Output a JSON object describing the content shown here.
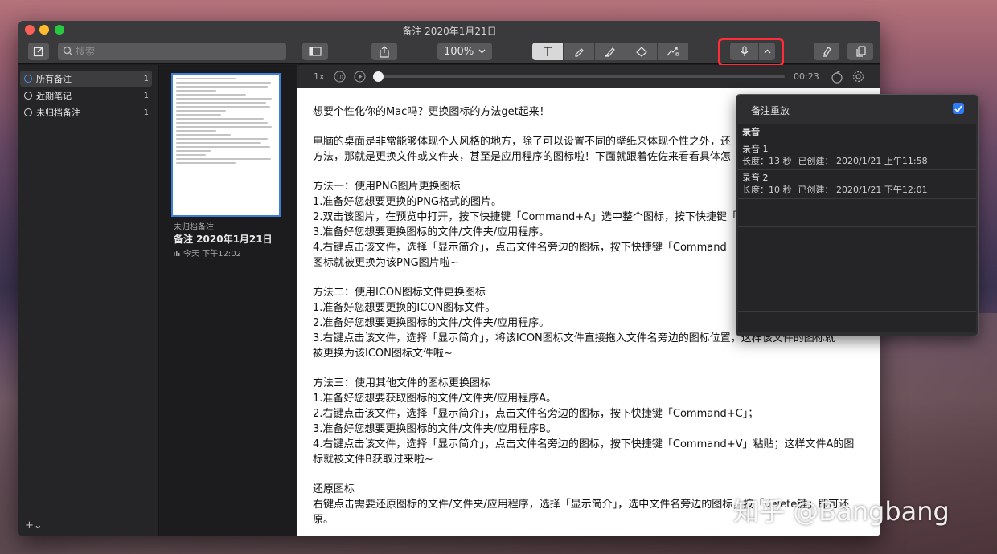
{
  "window": {
    "title": "备注 2020年1月21日"
  },
  "toolbar": {
    "search_placeholder": "搜索",
    "zoom": "100%"
  },
  "sidebar": {
    "items": [
      {
        "label": "所有备注",
        "count": "1"
      },
      {
        "label": "近期笔记",
        "count": "1"
      },
      {
        "label": "未归档备注",
        "count": "1"
      }
    ],
    "add_label": "+⌄"
  },
  "note_list": {
    "folder": "未归档备注",
    "title": "备注 2020年1月21日",
    "date": "今天 下午12:02"
  },
  "audio": {
    "speed": "1x",
    "time": "00:23"
  },
  "popover": {
    "title": "备注重放",
    "checked": true,
    "column_header": "录音",
    "recordings": [
      {
        "name": "录音 1",
        "length": "长度：13 秒",
        "created": "已创建：  2020/1/21 上午11:58"
      },
      {
        "name": "录音 2",
        "length": "长度：10 秒",
        "created": "已创建：  2020/1/21 下午12:01"
      }
    ]
  },
  "content": {
    "p1": [
      "想要个性化你的Mac吗？更换图标的方法get起来！"
    ],
    "p2": [
      "电脑的桌面是非常能够体现个人风格的地方，除了可以设置不同的壁纸来体现个性之外，还",
      "方法，那就是更换文件或文件夹，甚至是应用程序的图标啦！下面就跟着佐佐来看看具体怎"
    ],
    "p3": [
      "方法一：使用PNG图片更换图标",
      "1.准备好您想要更换的PNG格式的图片。",
      "2.双击该图片，在预览中打开，按下快捷键「Command+A」选中整个图标，按下快捷键「",
      "3.准备好您想要更换图标的文件/文件夹/应用程序。",
      "4.右键点击该文件，选择「显示简介」，点击文件名旁边的图标，按下快捷键「Command",
      "图标就被更换为该PNG图片啦~"
    ],
    "p4": [
      "方法二：使用ICON图标文件更换图标",
      "1.准备好您想要更换的ICON图标文件。",
      "2.准备好您想要更换图标的文件/文件夹/应用程序。",
      "3.右键点击该文件，选择「显示简介」，将该ICON图标文件直接拖入文件名旁边的图标位置，这样该文件的图标就",
      "被更换为该ICON图标文件啦~"
    ],
    "p5": [
      "方法三：使用其他文件的图标更换图标",
      "1.准备好您想要获取图标的文件/文件夹/应用程序A。",
      "2.右键点击该文件，选择「显示简介」，点击文件名旁边的图标，按下快捷键「Command+C」；",
      "3.准备好您想要更换图标的文件/文件夹/应用程序B。",
      "4.右键点击该文件，选择「显示简介」，点击文件名旁边的图标，按下快捷键「Command+V」粘贴；这样文件A的图",
      "标就被文件B获取过来啦~"
    ],
    "p6": [
      "还原图标",
      "右键点击需要还原图标的文件/文件夹/应用程序，选择「显示简介」，选中文件名旁边的图标，按「delete键」即可还",
      "原。"
    ]
  },
  "watermark": "知乎 @Bangbang"
}
